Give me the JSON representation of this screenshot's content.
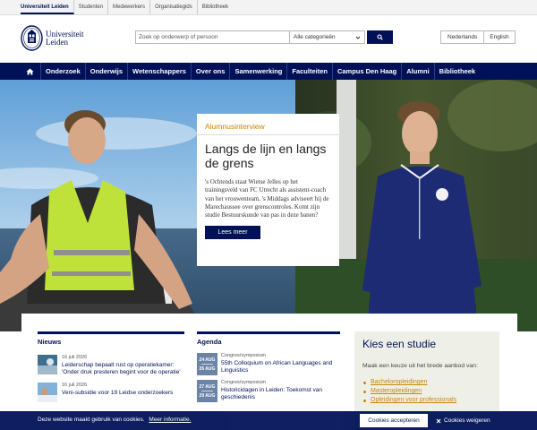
{
  "topbar": {
    "links": [
      "Universiteit Leiden",
      "Studenten",
      "Medewerkers",
      "Organisatiegids",
      "Bibliotheek"
    ]
  },
  "header": {
    "logo_line1": "Universiteit",
    "logo_line2": "Leiden",
    "search_placeholder": "Zoek op onderwerp of persoon",
    "search_category": "Alle categorieën",
    "languages": [
      "Nederlands",
      "English"
    ]
  },
  "nav": {
    "items": [
      "Onderzoek",
      "Onderwijs",
      "Wetenschappers",
      "Over ons",
      "Samenwerking",
      "Faculteiten",
      "Campus Den Haag",
      "Alumni",
      "Bibliotheek"
    ]
  },
  "hero": {
    "label": "Alumnusinterview",
    "title": "Langs de lijn en langs de grens",
    "text": "'s Ochtends staat Wietse Jelles op het trainingsveld van FC Utrecht als assistent-coach van het vrouwenteam. 's Middags adviseert hij de Marechaussee over grenscontroles. Komt zijn studie Bestuurskunde van pas in deze banen?",
    "button": "Lees meer"
  },
  "news": {
    "heading": "Nieuws",
    "items": [
      {
        "date": "16 juli 2026",
        "title": "Leiderschap bepaalt rust op operatiekamer: 'Onder druk presteren begint voor de operatie'"
      },
      {
        "date": "16 juli 2026",
        "title": "Veni-subsidie voor 19 Leidse onderzoekers"
      }
    ]
  },
  "agenda": {
    "heading": "Agenda",
    "items": [
      {
        "from_day": "24 AUG",
        "to_day": "26 AUG",
        "type": "Congres/symposium",
        "title": "55th Colloquium on African Languages and Linguistics"
      },
      {
        "from_day": "27 AUG",
        "to_day": "29 AUG",
        "type": "Congres/symposium",
        "title": "Historicidagen in Leiden: Toekomst van geschiedenis"
      }
    ]
  },
  "study": {
    "title": "Kies een studie",
    "text": "Maak een keuze uit het brede aanbod van:",
    "links": [
      "Bacheloropleidingen",
      "Masteropleidingen",
      "Opleidingen voor professionals"
    ]
  },
  "cookie": {
    "text": "Deze website maakt gebruik van cookies.",
    "link": "Meer informatie.",
    "accept": "Cookies accepteren",
    "deny": "Cookies weigeren"
  },
  "colors": {
    "brand_navy": "#001158",
    "accent_gold": "#c7860b",
    "study_bg": "#eef0e8"
  }
}
